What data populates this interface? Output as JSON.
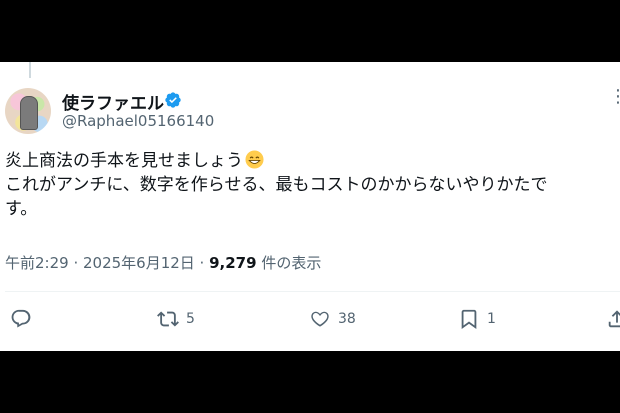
{
  "tweet": {
    "display_name": "使ラファエル",
    "handle": "@Raphael05166140",
    "text_line1": "炎上商法の手本を見せましょう",
    "text_line2": "これがアンチに、数字を作らせる、最もコストのかからないやりかたで",
    "text_line3": "す。",
    "emoji": "grinning-face",
    "timestamp": "午前2:29 · 2025年6月12日 · ",
    "views_count": "9,279",
    "views_label": " 件の表示"
  },
  "actions": {
    "reply": "",
    "retweet": "5",
    "like": "38",
    "bookmark": "1"
  },
  "colors": {
    "badge": "#1d9bf0",
    "text": "#0f1419",
    "secondary": "#536471"
  },
  "icons": [
    "verified-badge-icon",
    "more-icon",
    "reply-icon",
    "retweet-icon",
    "like-icon",
    "bookmark-icon",
    "share-icon"
  ]
}
